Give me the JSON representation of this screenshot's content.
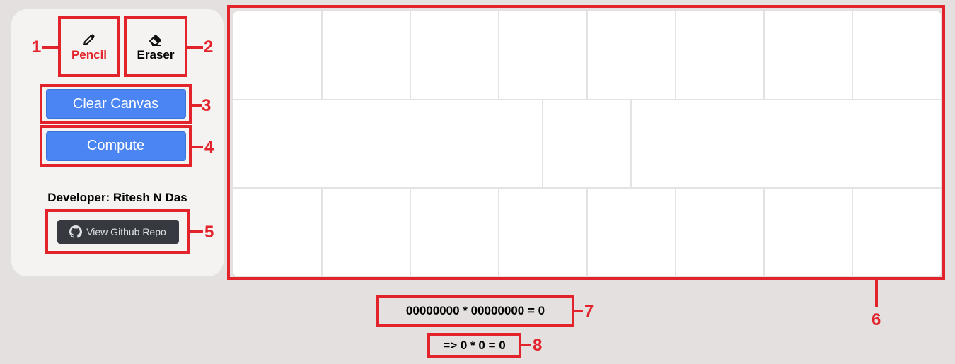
{
  "tools": {
    "pencil_label": "Pencil",
    "eraser_label": "Eraser",
    "active": "pencil"
  },
  "actions": {
    "clear_label": "Clear Canvas",
    "compute_label": "Compute"
  },
  "developer": {
    "text": "Developer: Ritesh N Das",
    "github_label": "View Github Repo"
  },
  "result": {
    "expression": "00000000 * 00000000 = 0",
    "evaluated": "=> 0 * 0 = 0"
  },
  "callouts": [
    "1",
    "2",
    "3",
    "4",
    "5",
    "6",
    "7",
    "8"
  ],
  "colors": {
    "accent": "#e3232c",
    "button": "#4b85f3",
    "github_button": "#363a40",
    "background": "#e3e0df"
  }
}
